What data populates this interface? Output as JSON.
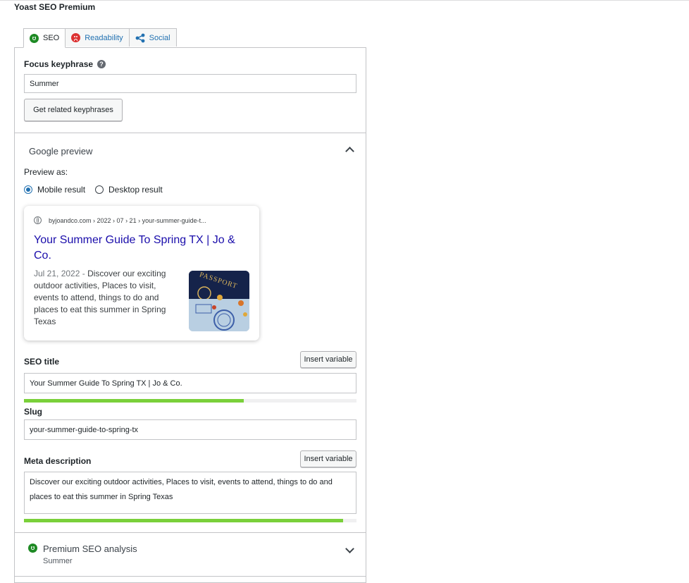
{
  "app": {
    "title": "Yoast SEO Premium"
  },
  "tabs": [
    {
      "label": "SEO",
      "icon": "smiley-good-icon",
      "active": true
    },
    {
      "label": "Readability",
      "icon": "smiley-bad-icon",
      "active": false
    },
    {
      "label": "Social",
      "icon": "share-icon",
      "active": false
    }
  ],
  "focus_keyphrase": {
    "label": "Focus keyphrase",
    "help": "?",
    "value": "Summer",
    "related_button": "Get related keyphrases"
  },
  "google_preview": {
    "section_title": "Google preview",
    "preview_as_label": "Preview as:",
    "options": [
      {
        "label": "Mobile result",
        "checked": true
      },
      {
        "label": "Desktop result",
        "checked": false
      }
    ],
    "card": {
      "url": "byjoandco.com › 2022 › 07 › 21 › your-summer-guide-t...",
      "title": "Your Summer Guide To Spring TX | Jo & Co.",
      "date": "Jul 21, 2022",
      "separator": " - ",
      "snippet": "Discover our exciting outdoor activities, Places to visit, events to attend, things to do and places to eat this summer in Spring Texas",
      "image_text": "PASSPORT"
    }
  },
  "seo_title": {
    "label": "SEO title",
    "insert_button": "Insert variable",
    "value": "Your Summer Guide To Spring TX | Jo & Co.",
    "progress": 0.66,
    "progress_color": "#7ad03a"
  },
  "slug": {
    "label": "Slug",
    "value": "your-summer-guide-to-spring-tx"
  },
  "meta_description": {
    "label": "Meta description",
    "insert_button": "Insert variable",
    "value": "Discover our exciting outdoor activities, Places to visit, events to attend, things to do and places to eat this summer in Spring Texas",
    "progress": 0.96,
    "progress_color": "#7ad03a"
  },
  "premium_analysis": {
    "title": "Premium SEO analysis",
    "subtitle": "Summer",
    "status_color": "#1e8a24"
  }
}
